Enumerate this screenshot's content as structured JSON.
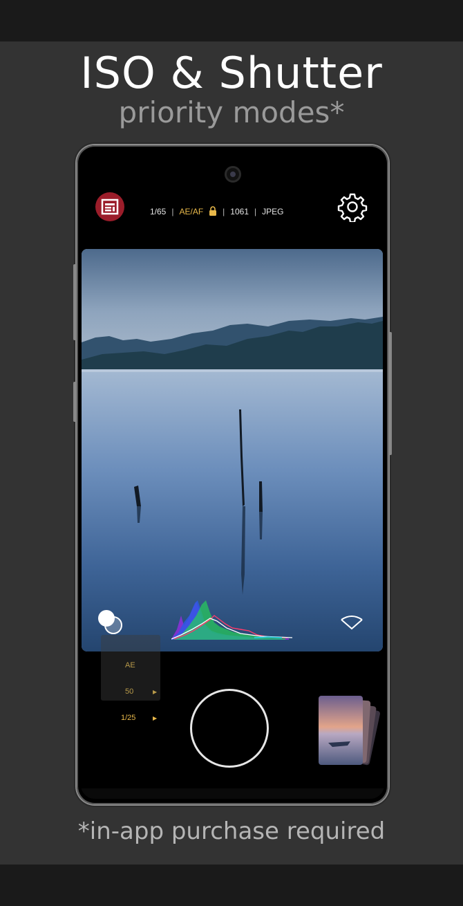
{
  "headline": "ISO & Shutter",
  "subhead": "priority modes*",
  "footnote": "*in-app purchase required",
  "colors": {
    "accent": "#e8b84a",
    "logo_bg": "#9b1d2a",
    "panel_bg": "#333333"
  },
  "status": {
    "shutter": "1/65",
    "mode": "AE/AF",
    "lock_icon": "lock-icon",
    "iso": "1061",
    "format": "JPEG"
  },
  "icons": {
    "logo": "filmic-logo-icon",
    "settings": "gear-icon",
    "exposure": "exposure-circles-icon",
    "collapse": "chevron-down-icon",
    "gallery": "gallery-stack-icon"
  },
  "controls": {
    "ae_label": "AE",
    "iso_value": "50",
    "shutter_value": "1/25"
  }
}
